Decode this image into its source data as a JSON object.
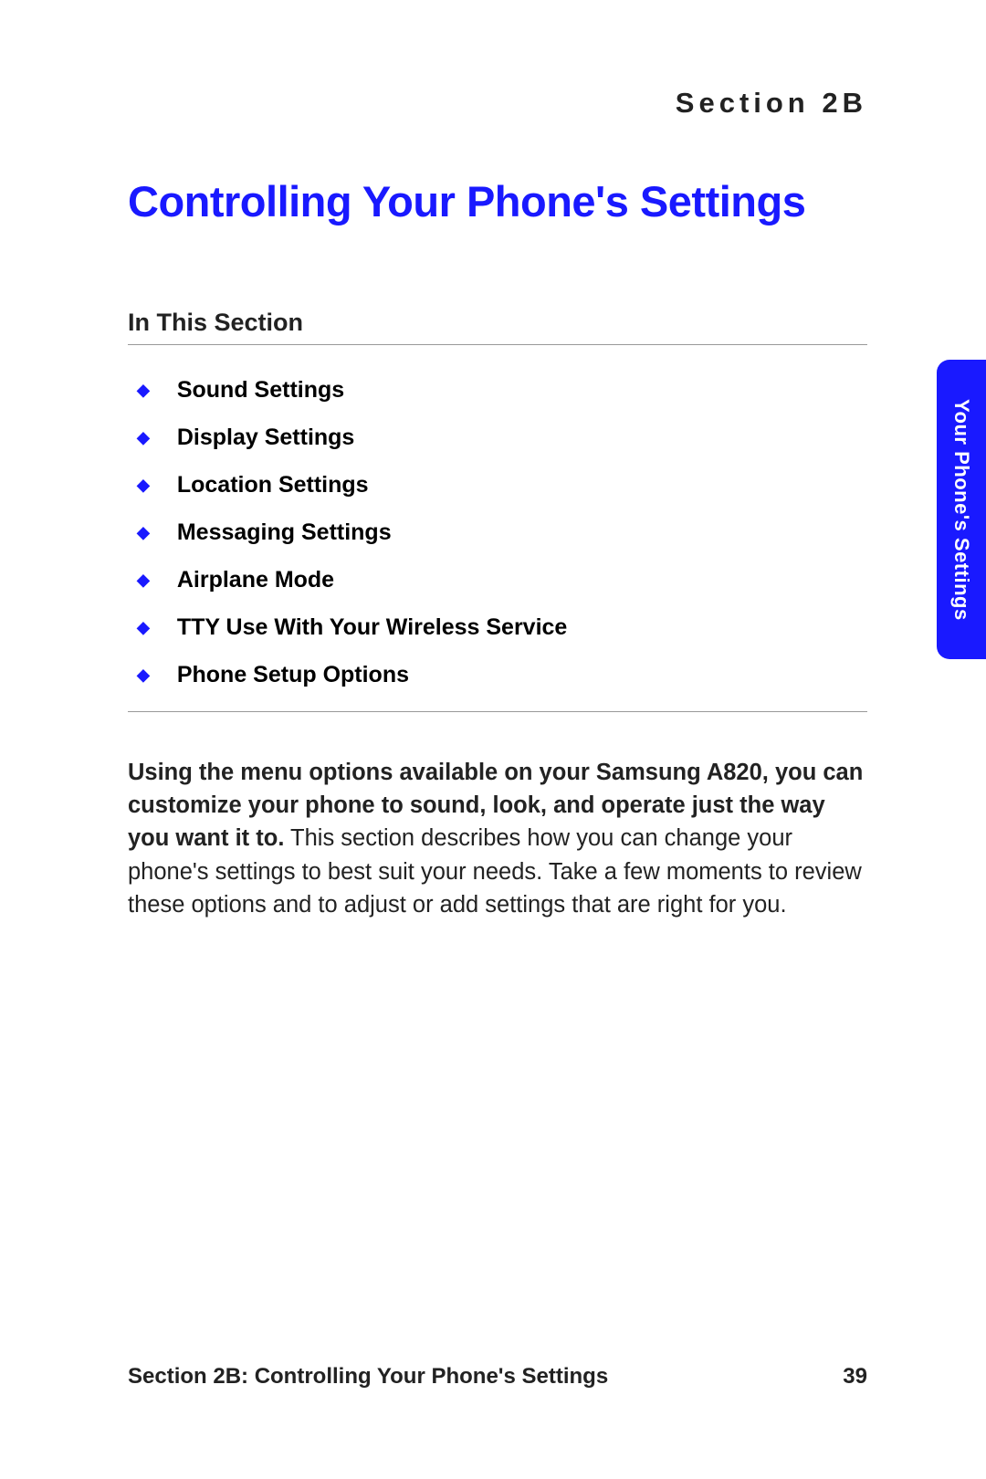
{
  "section_label": "Section 2B",
  "title": "Controlling Your Phone's Settings",
  "subheading": "In This Section",
  "toc": [
    "Sound Settings",
    "Display Settings",
    "Location Settings",
    "Messaging Settings",
    "Airplane Mode",
    "TTY Use With Your Wireless Service",
    "Phone Setup Options"
  ],
  "body_bold": "Using the menu options available on your Samsung A820, you can customize your phone to sound, look, and operate just the way you want it to.",
  "body_rest": " This section describes how you can change your phone's settings to best suit your needs. Take a few moments to review these options and to adjust or add settings that are right for you.",
  "side_tab": "Your Phone's Settings",
  "footer_left": "Section 2B: Controlling Your Phone's Settings",
  "footer_right": "39"
}
